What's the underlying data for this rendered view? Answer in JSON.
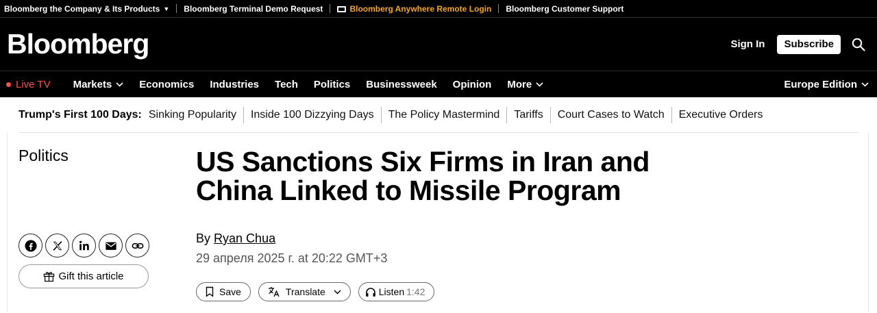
{
  "topbar": {
    "items": [
      "Bloomberg the Company & Its Products",
      "Bloomberg Terminal Demo Request",
      "Bloomberg Anywhere Remote Login",
      "Bloomberg Customer Support"
    ]
  },
  "header": {
    "logo": "Bloomberg",
    "sign_in": "Sign In",
    "subscribe": "Subscribe"
  },
  "nav": {
    "live": "Live TV",
    "items": [
      "Markets",
      "Economics",
      "Industries",
      "Tech",
      "Politics",
      "Businessweek",
      "Opinion",
      "More"
    ],
    "edition": "Europe Edition"
  },
  "trending": {
    "title": "Trump's First 100 Days:",
    "links": [
      "Sinking Popularity",
      "Inside 100 Dizzying Days",
      "The Policy Mastermind",
      "Tariffs",
      "Court Cases to Watch",
      "Executive Orders"
    ]
  },
  "article": {
    "section": "Politics",
    "headline": "US Sanctions Six Firms in Iran and China Linked to Missile Program",
    "by": "By",
    "author": "Ryan Chua",
    "date": "29 апреля 2025 г. at 20:22 GMT+3",
    "gift": "Gift this article",
    "save": "Save",
    "translate": "Translate",
    "listen": "Listen",
    "listen_duration": "1:42"
  },
  "colors": {
    "accent_orange": "#f5a623",
    "live_red": "#ff5040"
  }
}
